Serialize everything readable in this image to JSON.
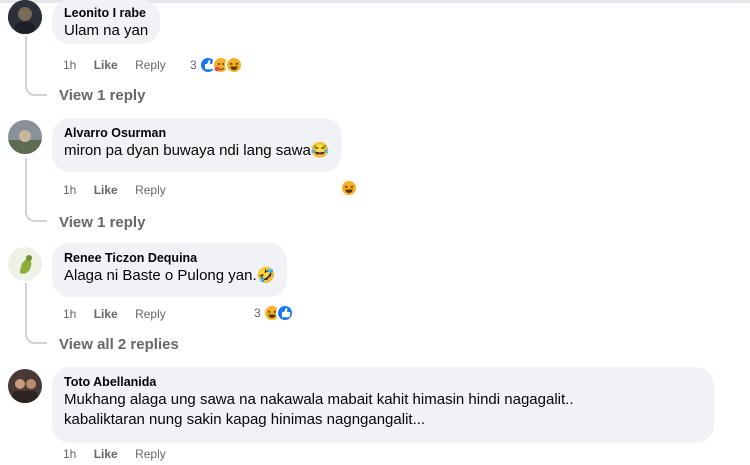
{
  "comments": [
    {
      "author": "Leonito I rabe",
      "text": "Ulam na yan",
      "time": "1h",
      "like_label": "Like",
      "reply_label": "Reply",
      "reaction_count": "3",
      "reactions": [
        "like-icon",
        "care-icon",
        "haha-icon"
      ],
      "view_replies": "View 1 reply"
    },
    {
      "author": "Alvarro Osurman",
      "text": "miron pa dyan buwaya ndi lang sawa😂",
      "time": "1h",
      "like_label": "Like",
      "reply_label": "Reply",
      "reaction_count": "",
      "reactions": [
        "haha-icon"
      ],
      "view_replies": "View 1 reply"
    },
    {
      "author": "Renee Ticzon Dequina",
      "text": "Alaga ni Baste o Pulong yan.🤣",
      "time": "1h",
      "like_label": "Like",
      "reply_label": "Reply",
      "reaction_count": "3",
      "reactions": [
        "haha-icon",
        "like-icon"
      ],
      "view_replies": "View all 2 replies"
    },
    {
      "author": "Toto Abellanida",
      "text_line1": "Mukhang alaga ung sawa na nakawala mabait kahit himasin hindi nagagalit..",
      "text_line2": "kabaliktaran nung sakin kapag hinimas nagngangalit...",
      "time": "1h",
      "like_label": "Like",
      "reply_label": "Reply"
    }
  ],
  "colors": {
    "bubble": "#f0f2f5",
    "meta_text": "#65676b",
    "like_blue": "#1877f2",
    "haha_yellow": "#f7b125"
  }
}
